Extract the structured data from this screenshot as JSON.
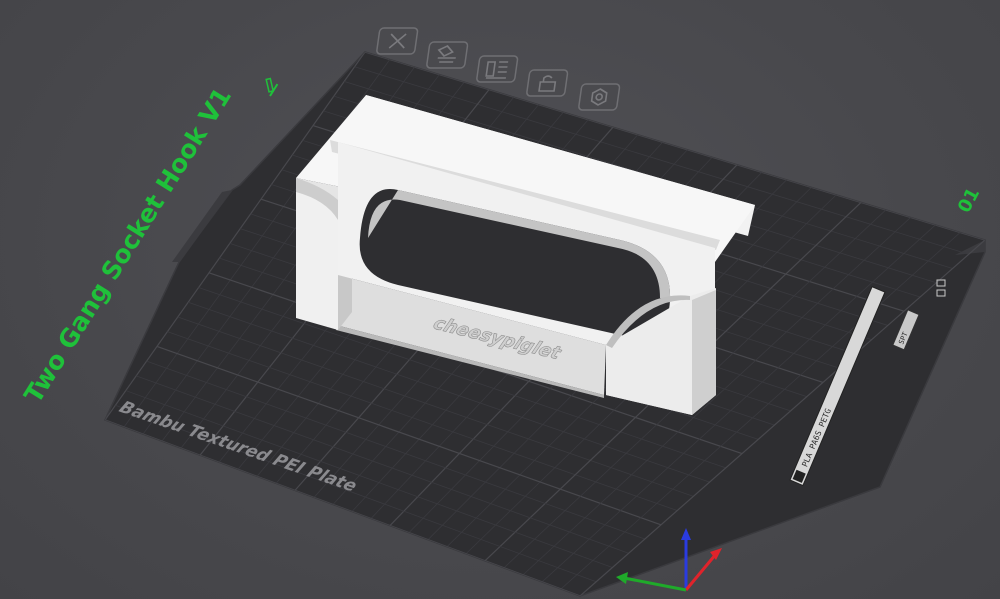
{
  "project": {
    "title": "Two Gang Socket Hook V1",
    "plate_number": "01"
  },
  "plate": {
    "name": "Bambu Textured PEI Plate",
    "filament_tag": "PLA PA6S PETG",
    "side_tag": "SPT"
  },
  "model": {
    "emboss_text": "cheesypiglet"
  },
  "plate_toolbar": [
    {
      "name": "delete-plate-icon"
    },
    {
      "name": "arrange-plate-icon"
    },
    {
      "name": "plate-settings-icon"
    },
    {
      "name": "lock-plate-icon"
    },
    {
      "name": "plate-gear-icon"
    }
  ],
  "colors": {
    "accent": "#1fc13a",
    "bed": "#2e2e31",
    "grid": "#3d3d41",
    "model": "#e9e9e9",
    "axis_x": "#e0232b",
    "axis_y": "#1faa2a",
    "axis_z": "#2a3be0"
  }
}
